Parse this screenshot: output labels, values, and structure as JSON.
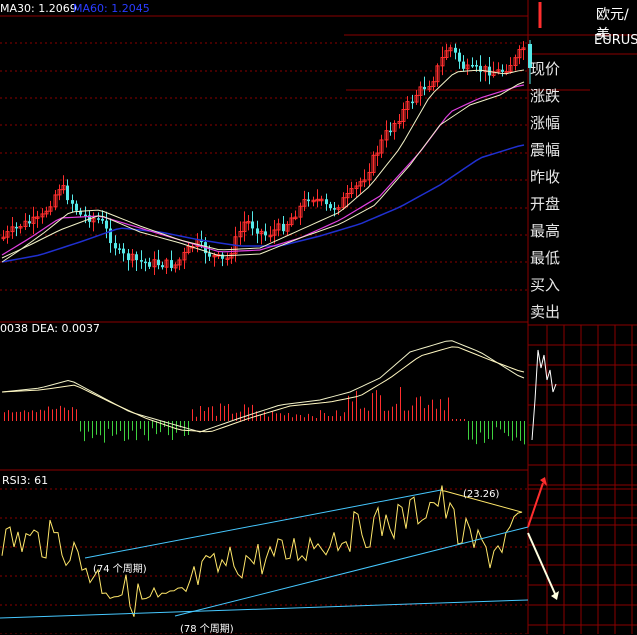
{
  "panels": {
    "price": {
      "ma30_label": "MA30: 1.2069",
      "ma60_label": "MA60: 1.2045"
    },
    "macd": {
      "label": "0038 DEA: 0.0037"
    },
    "rsi": {
      "label": "RSI3: 61"
    }
  },
  "annotations": {
    "left_period": "(74 个周期)",
    "bottom_period": "(78 个周期)",
    "peak_value": "(23.26)"
  },
  "sidebar": {
    "title": "欧元/美",
    "pair": "EURUS",
    "items": [
      {
        "label": "现价"
      },
      {
        "label": "涨跌"
      },
      {
        "label": "涨幅"
      },
      {
        "label": "震幅"
      },
      {
        "label": "昨收"
      },
      {
        "label": "开盘"
      },
      {
        "label": "最高"
      },
      {
        "label": "最低"
      },
      {
        "label": "买入"
      },
      {
        "label": "卖出"
      }
    ]
  },
  "colors": {
    "up": "#ff2e2e",
    "down": "#55e8e8",
    "ma_white": "#f2f2c8",
    "ma_magenta": "#e040e0",
    "ma_blue": "#2030d0",
    "grid": "#8a0000",
    "trend": "#46c8ff",
    "rsi": "#ffe76a"
  }
}
